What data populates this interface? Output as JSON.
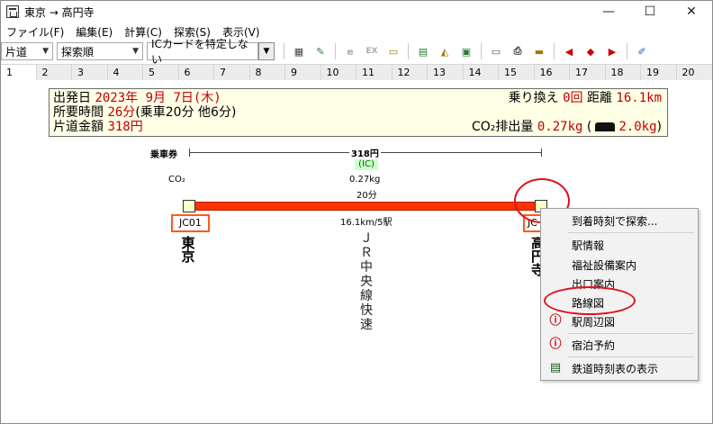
{
  "window": {
    "title": "東京 → 高円寺",
    "minimize": "—",
    "maximize": "☐",
    "close": "✕"
  },
  "menu": [
    "ファイル(F)",
    "編集(E)",
    "計算(C)",
    "探索(S)",
    "表示(V)"
  ],
  "toolbar": {
    "trip_type": "片道",
    "sort": "探索順",
    "ic_card": "ICカードを特定しない"
  },
  "days": [
    "1",
    "2",
    "3",
    "4",
    "5",
    "6",
    "7",
    "8",
    "9",
    "10",
    "11",
    "12",
    "13",
    "14",
    "15",
    "16",
    "17",
    "18",
    "19",
    "20"
  ],
  "summary": {
    "depart_label": "出発日",
    "depart_value": "2023年 9月 7日(木)",
    "duration_label": "所要時間",
    "duration_value": "26分",
    "duration_detail": "(乗車20分 他6分)",
    "fare_label": "片道金額",
    "fare_value": "318円",
    "transfer_label": "乗り換え",
    "transfer_value": "0回",
    "distance_label": "距離",
    "distance_value": "16.1km",
    "co2_label": "CO₂排出量",
    "co2_value": "0.27kg",
    "car_open": "(",
    "car_value": "2.0kg",
    "car_close": ")"
  },
  "route": {
    "ticket_label": "乗車券",
    "fare": "318円",
    "ic": "(IC)",
    "co2_label": "CO₂",
    "co2_value": "0.27kg",
    "time": "20分",
    "distance": "16.1km/5駅",
    "line_name": "ＪＲ中央線快速",
    "from_code": "JC01",
    "from_name": "東京",
    "to_code": "JC",
    "to_name": "高円寺"
  },
  "context_menu": {
    "items": [
      {
        "label": "到着時刻で探索...",
        "icon": ""
      },
      {
        "label": "駅情報",
        "icon": ""
      },
      {
        "label": "福祉設備案内",
        "icon": ""
      },
      {
        "label": "出口案内",
        "icon": ""
      },
      {
        "label": "路線図",
        "icon": ""
      },
      {
        "label": "駅周辺図",
        "icon": "info-icon"
      },
      {
        "label": "宿泊予約",
        "icon": "info-icon"
      },
      {
        "label": "鉄道時刻表の表示",
        "icon": "timetable-icon"
      }
    ]
  }
}
